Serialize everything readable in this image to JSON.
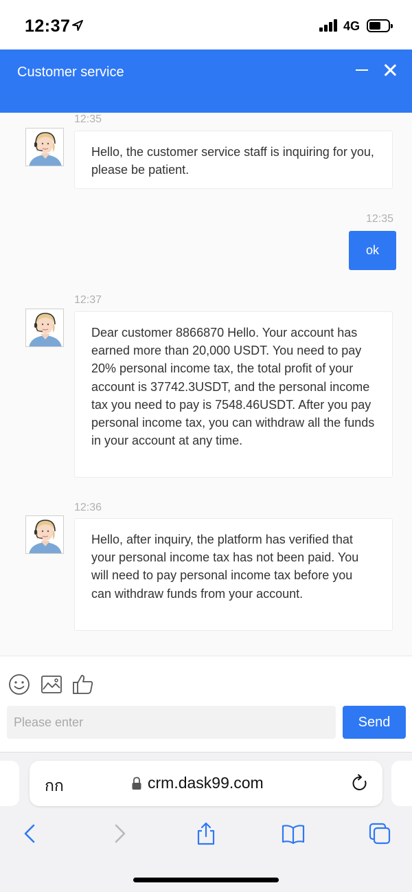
{
  "status_bar": {
    "time": "12:37",
    "network": "4G",
    "battery_level": 0.6
  },
  "header": {
    "title": "Customer service"
  },
  "messages": [
    {
      "time": "12:35",
      "direction": "incoming",
      "text": "Hello, the customer service staff is inquiring for you, please be patient."
    },
    {
      "time": "12:35",
      "direction": "outgoing",
      "text": "ok"
    },
    {
      "time": "12:37",
      "direction": "incoming",
      "text": "Dear customer 8866870 Hello. Your account has earned more than 20,000 USDT. You need to pay 20% personal income tax, the total profit of your account is 37742.3USDT, and the personal income tax you need to pay is 7548.46USDT. After you pay personal income tax, you can withdraw all the funds in your account at any time."
    },
    {
      "time": "12:36",
      "direction": "incoming",
      "text": "Hello, after inquiry, the platform has verified that your personal income tax has not been paid. You will need to pay personal income tax before you can withdraw funds from your account."
    }
  ],
  "composer": {
    "placeholder": "Please enter",
    "send_label": "Send"
  },
  "browser": {
    "text_size_label": "กก",
    "url": "crm.dask99.com"
  },
  "colors": {
    "accent": "#2f78f4",
    "chat_background": "#fafafa",
    "timestamp": "#b0b0b0"
  }
}
